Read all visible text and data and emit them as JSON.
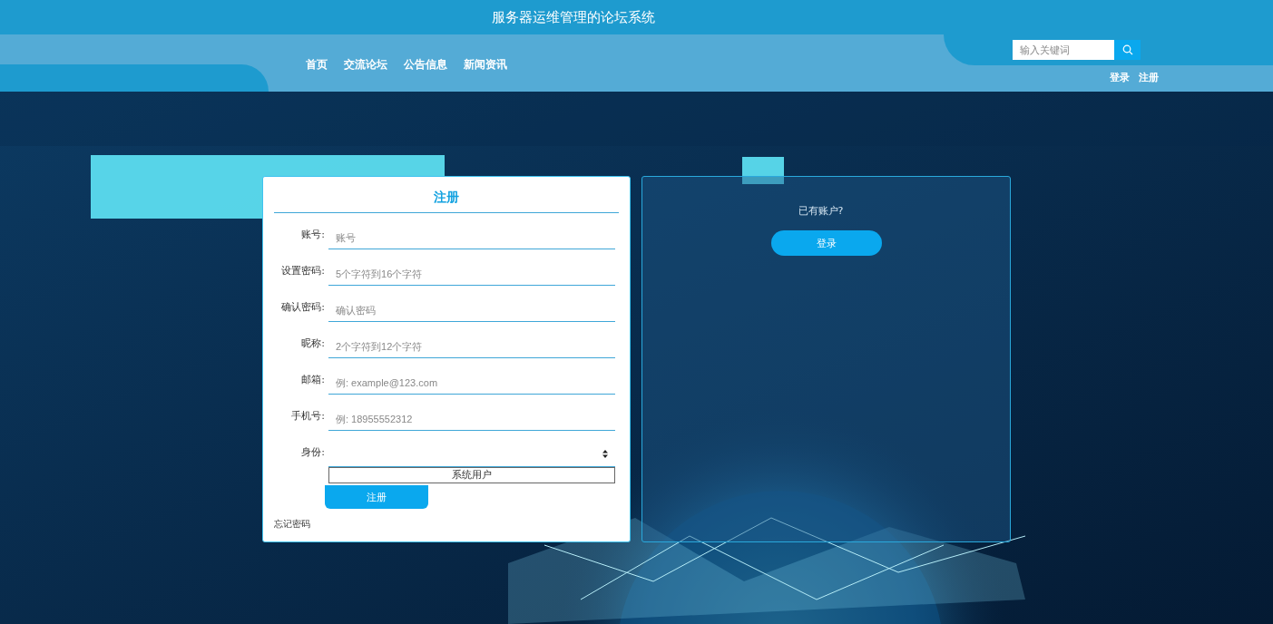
{
  "site_title": "服务器运维管理的论坛系统",
  "nav": [
    {
      "label": "首页"
    },
    {
      "label": "交流论坛"
    },
    {
      "label": "公告信息"
    },
    {
      "label": "新闻资讯"
    }
  ],
  "search": {
    "placeholder": "输入关键词"
  },
  "auth_links": [
    "登录",
    "注册"
  ],
  "register_form": {
    "title": "注册",
    "fields": [
      {
        "kind": "input",
        "label": "账号:",
        "placeholder": "账号"
      },
      {
        "kind": "input",
        "label": "设置密码:",
        "placeholder": "5个字符到16个字符"
      },
      {
        "kind": "input",
        "label": "确认密码:",
        "placeholder": "确认密码"
      },
      {
        "kind": "input",
        "label": "昵称:",
        "placeholder": "2个字符到12个字符"
      },
      {
        "kind": "input",
        "label": "邮箱:",
        "placeholder": "例: example@123.com"
      },
      {
        "kind": "input",
        "label": "手机号:",
        "placeholder": "例: 18955552312"
      },
      {
        "kind": "select",
        "label": "身份:",
        "expanded": true,
        "options": [
          "系统用户"
        ]
      }
    ],
    "submit": "注册",
    "forgot_link": "忘记密码"
  },
  "login_panel": {
    "prompt": "已有账户?",
    "button": "登录"
  }
}
